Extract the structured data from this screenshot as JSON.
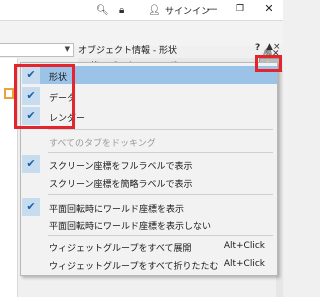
{
  "titlebar": {
    "search_icon": "search-icon",
    "lock_icon": "lock-icon",
    "user_icon": "user-icon",
    "signin_label": "サインイン",
    "minimize": "—",
    "maximize": "❐",
    "close": "✕"
  },
  "panel": {
    "title": "オブジェクト情報 - 形状",
    "help": "?",
    "pin": "×"
  },
  "tabs_peek": [
    "状",
    "データ",
    "レンダー"
  ],
  "menu": {
    "tab_items": [
      {
        "label": "形状",
        "checked": true
      },
      {
        "label": "データ",
        "checked": true
      },
      {
        "label": "レンダー",
        "checked": true
      }
    ],
    "dock_all": "すべてのタブをドッキング",
    "screen_full": "スクリーン座標をフルラベルで表示",
    "screen_short": "スクリーン座標を簡略ラベルで表示",
    "plane_show": "平面回転時にワールド座標を表示",
    "plane_hide": "平面回転時にワールド座標を表示しない",
    "expand_all": "ウィジェットグループをすべて展開",
    "expand_shortcut": "Alt+Click",
    "collapse_all": "ウィジェットグループをすべて折りたたむ",
    "collapse_shortcut": "Alt+Click"
  },
  "colors": {
    "highlight": "#9bc3e8",
    "check_bg": "#c7dcef",
    "annotation_red": "#e3262d"
  }
}
